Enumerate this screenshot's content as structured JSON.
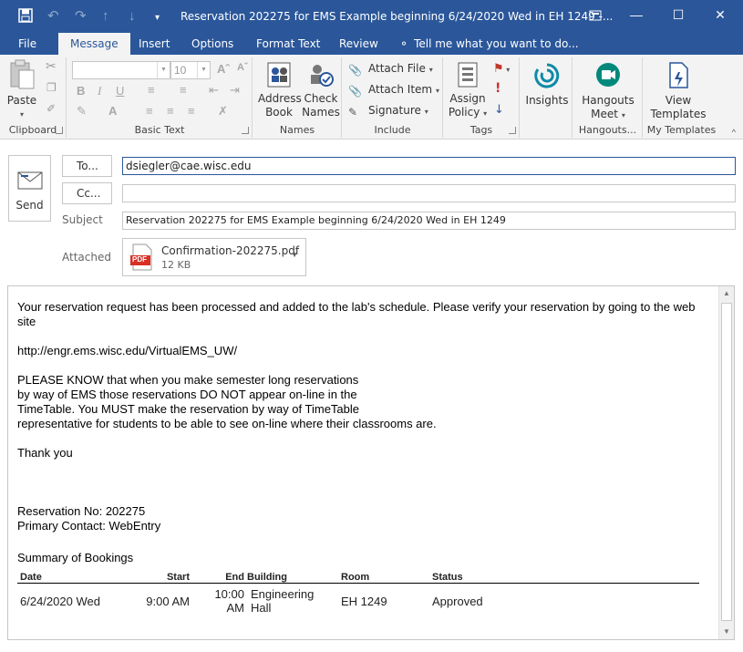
{
  "window": {
    "title": "Reservation 202275 for EMS Example beginning 6/24/2020 Wed in EH 1249 -...",
    "accent_color": "#2b579a"
  },
  "quick_access": {
    "save_icon": "save-icon",
    "undo_icon": "undo-icon",
    "redo_icon": "redo-icon",
    "up_icon": "arrow-up-icon",
    "down_icon": "arrow-down-icon",
    "customize_icon": "customize-icon"
  },
  "tabs": [
    {
      "label": "File"
    },
    {
      "label": "Message"
    },
    {
      "label": "Insert"
    },
    {
      "label": "Options"
    },
    {
      "label": "Format Text"
    },
    {
      "label": "Review"
    }
  ],
  "tell_me": "Tell me what you want to do...",
  "ribbon": {
    "clipboard": {
      "label": "Clipboard",
      "paste": "Paste"
    },
    "basic_text": {
      "label": "Basic Text",
      "font_size": "10"
    },
    "names": {
      "label": "Names",
      "address_book_1": "Address",
      "address_book_2": "Book",
      "check_names_1": "Check",
      "check_names_2": "Names"
    },
    "include": {
      "label": "Include",
      "attach_file": "Attach File",
      "attach_item": "Attach Item",
      "signature": "Signature"
    },
    "tags": {
      "label": "Tags",
      "assign_policy_1": "Assign",
      "assign_policy_2": "Policy"
    },
    "insights": {
      "label": "Insights"
    },
    "hangouts": {
      "label": "Hangouts...",
      "meet_1": "Hangouts",
      "meet_2": "Meet"
    },
    "my_templates": {
      "label": "My Templates",
      "view_1": "View",
      "view_2": "Templates"
    }
  },
  "compose": {
    "send": "Send",
    "to_button": "To...",
    "cc_button": "Cc...",
    "to_value": "dsiegler@cae.wisc.edu",
    "cc_value": "",
    "subject_label": "Subject",
    "subject_value": "Reservation 202275 for EMS Example beginning 6/24/2020 Wed in EH 1249",
    "attached_label": "Attached",
    "attachment": {
      "name": "Confirmation-202275.pdf",
      "size": "12 KB",
      "badge": "PDF"
    }
  },
  "body": {
    "para1": "Your reservation request has been processed and added to the lab's schedule. Please verify your reservation by going to the web site",
    "url": "http://engr.ems.wisc.edu/VirtualEMS_UW/",
    "notice_lines": [
      "PLEASE KNOW that when you make semester long reservations",
      "by way of EMS those reservations DO NOT appear on-line in the",
      "TimeTable. You MUST make the reservation by way of TimeTable",
      "representative for students to be able to see on-line where their classrooms are."
    ],
    "thanks": "Thank you",
    "reservation_no": "Reservation No: 202275",
    "primary_contact": "Primary Contact: WebEntry",
    "summary": "Summary of Bookings",
    "table": {
      "headers": [
        "Date",
        "Start",
        "End",
        "Building",
        "Room",
        "Status"
      ],
      "rows": [
        [
          "6/24/2020 Wed",
          "9:00 AM",
          "10:00 AM",
          "Engineering Hall",
          "EH 1249",
          "Approved"
        ]
      ]
    }
  }
}
